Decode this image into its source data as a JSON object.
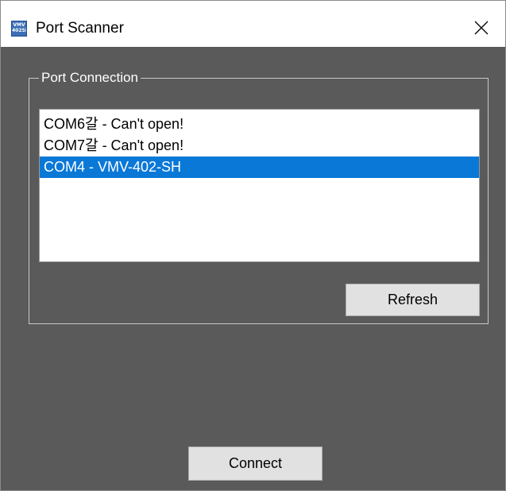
{
  "window": {
    "title": "Port Scanner",
    "icon_name": "vmv-app-icon",
    "icon_text_line1": "VMV",
    "icon_text_line2": "402SH"
  },
  "port_connection": {
    "group_label": "Port Connection",
    "ports": [
      {
        "label": "COM6갈 - Can't open!",
        "selected": false
      },
      {
        "label": "COM7갈 - Can't open!",
        "selected": false
      },
      {
        "label": "COM4 - VMV-402-SH",
        "selected": true
      }
    ],
    "refresh_label": "Refresh"
  },
  "footer": {
    "connect_label": "Connect"
  },
  "colors": {
    "client_background": "#5a5a5a",
    "selection": "#0a78d7",
    "button_face": "#e1e1e1"
  }
}
